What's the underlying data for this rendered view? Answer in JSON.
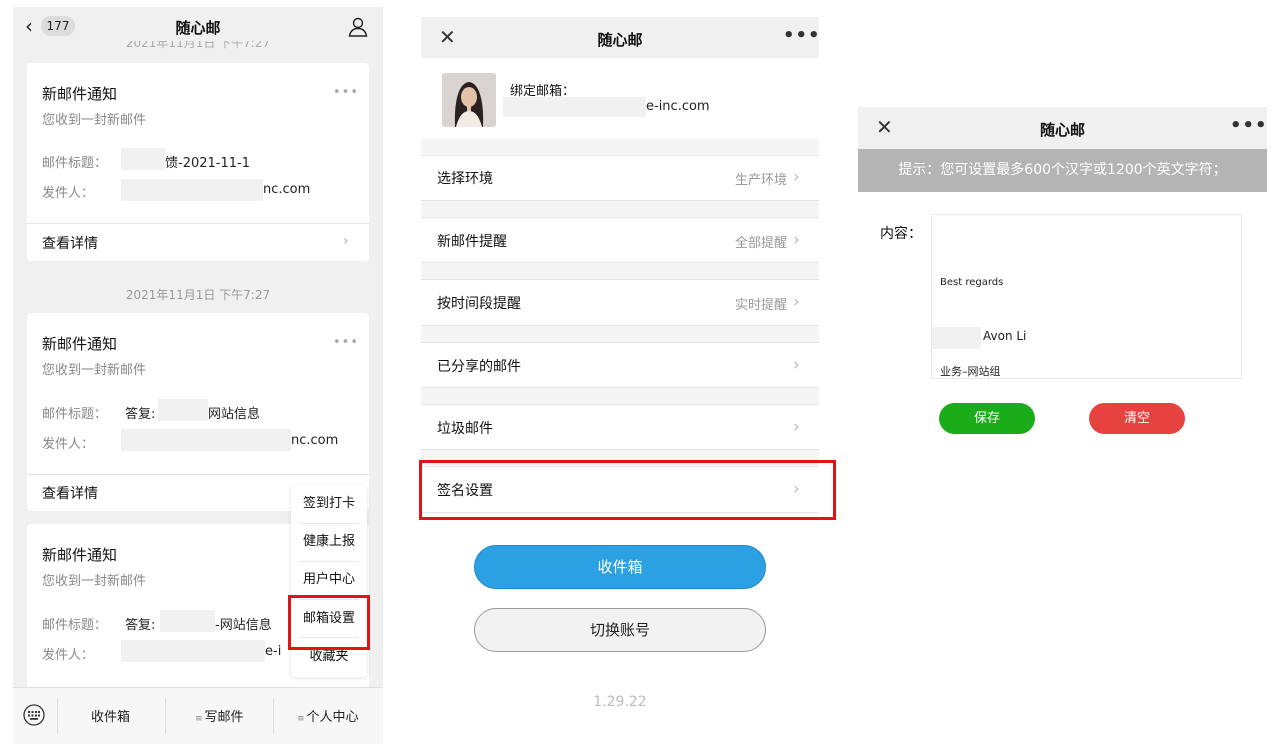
{
  "panel1": {
    "nav": {
      "back_count": "177",
      "title": "随心邮"
    },
    "clipped_timestamp": "2021年11月1日 下午7:27",
    "cards": [
      {
        "title": "新邮件通知",
        "subtitle": "您收到一封新邮件",
        "subject_label": "邮件标题：",
        "subject_prefix": "",
        "subject_suffix": "馈-2021-11-1",
        "sender_label": "发件人：",
        "sender_suffix": "nc.com",
        "detail_label": "查看详情"
      },
      {
        "title": "新邮件通知",
        "subtitle": "您收到一封新邮件",
        "subject_label": "邮件标题：",
        "subject_prefix": "答复:",
        "subject_suffix": "网站信息",
        "sender_label": "发件人：",
        "sender_suffix": "nc.com",
        "detail_label": "查看详情"
      },
      {
        "title": "新邮件通知",
        "subtitle": "您收到一封新邮件",
        "subject_label": "邮件标题：",
        "subject_prefix": "答复:",
        "subject_suffix": "-网站信息",
        "sender_label": "发件人：",
        "sender_suffix": "e-i"
      }
    ],
    "timestamp": "2021年11月1日 下午7:27",
    "popup_menu": [
      "签到打卡",
      "健康上报",
      "用户中心",
      "邮箱设置",
      "收藏夹"
    ],
    "tabbar": {
      "inbox": "收件箱",
      "compose": "写邮件",
      "profile": "个人中心",
      "menu_glyph": "≡"
    }
  },
  "panel2": {
    "nav": {
      "title": "随心邮",
      "close_glyph": "✕",
      "more_glyph": "•••"
    },
    "bind_label": "绑定邮箱：",
    "bind_value": "e-inc.com",
    "rows": [
      {
        "label": "选择环境",
        "value": "生产环境"
      },
      {
        "label": "新邮件提醒",
        "value": "全部提醒"
      },
      {
        "label": "按时间段提醒",
        "value": "实时提醒"
      },
      {
        "label": "已分享的邮件",
        "value": ""
      },
      {
        "label": "垃圾邮件",
        "value": ""
      },
      {
        "label": "签名设置",
        "value": ""
      }
    ],
    "inbox_button": "收件箱",
    "switch_button": "切换账号",
    "version": "1.29.22"
  },
  "panel3": {
    "nav": {
      "title": "随心邮",
      "close_glyph": "✕",
      "more_glyph": "•••"
    },
    "hint": "提示：您可设置最多600个汉字或1200个英文字符；",
    "content_label": "内容：",
    "signature": {
      "line1": "Best regards",
      "line2": "Avon Li",
      "line3": "业务–网站组"
    },
    "save_button": "保存",
    "clear_button": "清空"
  },
  "colors": {
    "accent_blue": "#2ba0e2",
    "save_green": "#1aad19",
    "clear_red": "#e64340",
    "highlight_red": "#e01414"
  }
}
